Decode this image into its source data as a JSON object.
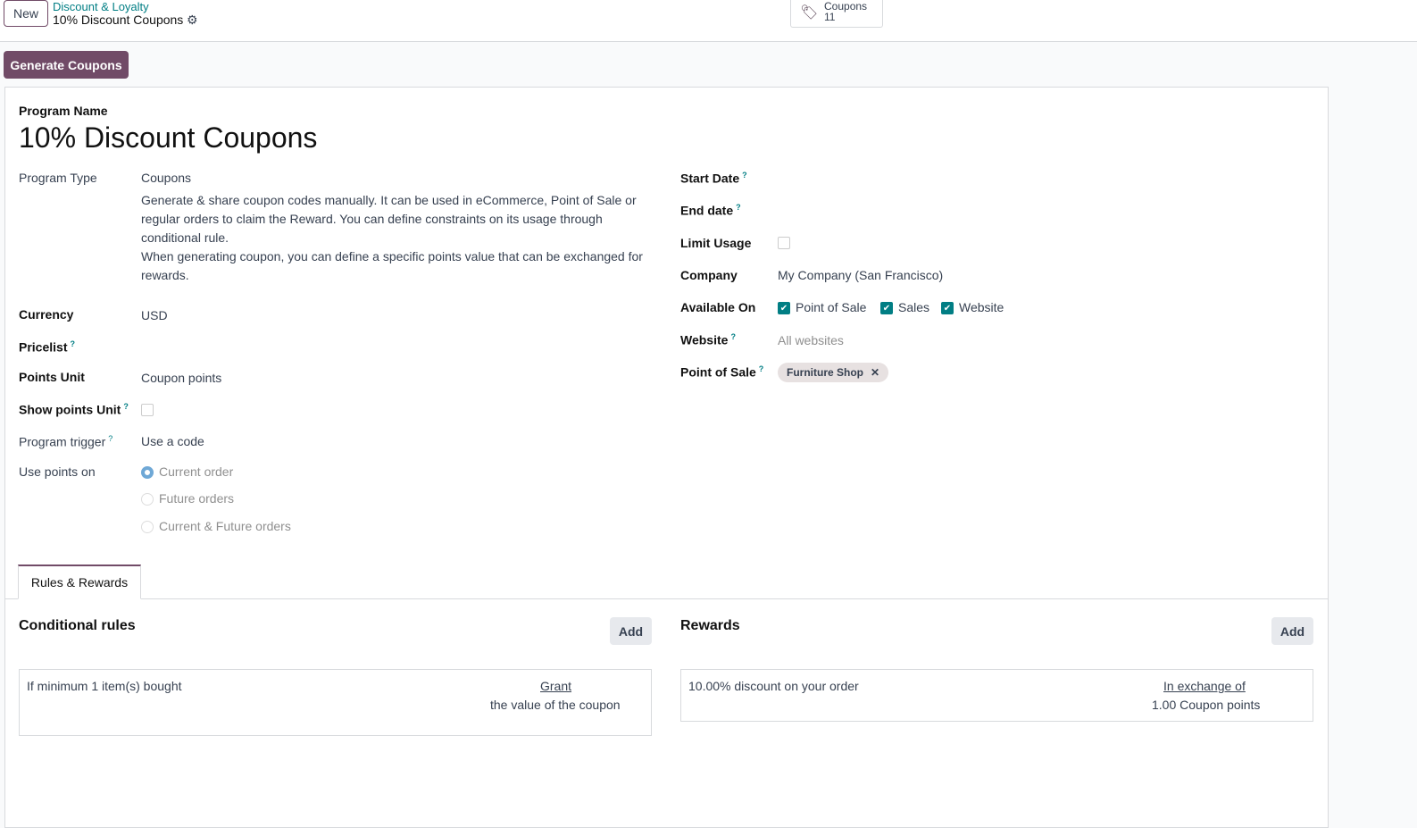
{
  "header": {
    "new_label": "New",
    "breadcrumb_parent": "Discount & Loyalty",
    "breadcrumb_current": "10% Discount Coupons",
    "smart_button": {
      "label": "Coupons",
      "count": "11"
    }
  },
  "actions": {
    "generate": "Generate Coupons"
  },
  "form": {
    "program_name_label": "Program Name",
    "program_name": "10% Discount Coupons",
    "program_type_label": "Program Type",
    "program_type": "Coupons",
    "program_type_desc1": "Generate & share coupon codes manually. It can be used in eCommerce, Point of Sale or regular orders to claim the Reward. You can define constraints on its usage through conditional rule.",
    "program_type_desc2": "When generating coupon, you can define a specific points value that can be exchanged for rewards.",
    "currency_label": "Currency",
    "currency": "USD",
    "pricelist_label": "Pricelist",
    "points_unit_label": "Points Unit",
    "points_unit": "Coupon points",
    "show_points_label": "Show points Unit",
    "trigger_label": "Program trigger",
    "trigger": "Use a code",
    "use_points_label": "Use points on",
    "use_points_options": [
      "Current order",
      "Future orders",
      "Current & Future orders"
    ],
    "start_date_label": "Start Date",
    "end_date_label": "End date",
    "limit_usage_label": "Limit Usage",
    "company_label": "Company",
    "company": "My Company (San Francisco)",
    "available_on_label": "Available On",
    "available_on": [
      "Point of Sale",
      "Sales",
      "Website"
    ],
    "website_label": "Website",
    "website_placeholder": "All websites",
    "pos_label": "Point of Sale",
    "pos_tag": "Furniture Shop",
    "help": "?"
  },
  "tabs": {
    "rules_rewards": "Rules & Rewards"
  },
  "rules": {
    "title": "Conditional rules",
    "add": "Add",
    "item": "If minimum 1 item(s) bought",
    "grant": "Grant",
    "grant_desc": "the value of the coupon"
  },
  "rewards": {
    "title": "Rewards",
    "add": "Add",
    "item": "10.00% discount on your order",
    "exchange": "In exchange of",
    "exchange_desc": "1.00 Coupon points"
  }
}
